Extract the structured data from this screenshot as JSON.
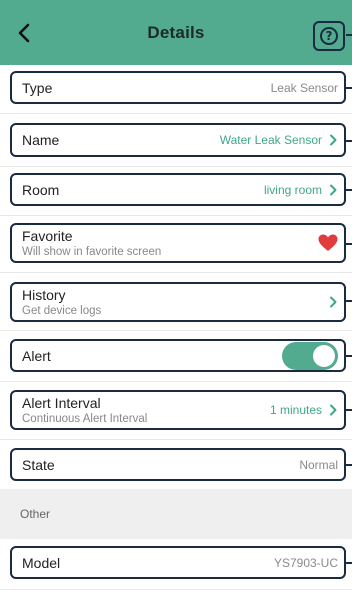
{
  "header": {
    "title": "Details",
    "back_icon": "chevron-left-icon",
    "help_icon": "question-circle-icon",
    "background": "#52aa8f"
  },
  "rows": {
    "type": {
      "label": "Type",
      "value": "Leak Sensor"
    },
    "name": {
      "label": "Name",
      "value": "Water Leak Sensor"
    },
    "room": {
      "label": "Room",
      "value": "living room"
    },
    "favorite": {
      "label": "Favorite",
      "sublabel": "Will show in favorite screen",
      "icon": "heart-icon",
      "color": "#e03c3c"
    },
    "history": {
      "label": "History",
      "sublabel": "Get device logs"
    },
    "alert": {
      "label": "Alert",
      "toggle_on": true
    },
    "alert_interval": {
      "label": "Alert Interval",
      "sublabel": "Continuous Alert Interval",
      "value": "1 minutes"
    },
    "state": {
      "label": "State",
      "value": "Normal"
    }
  },
  "section_other": {
    "label": "Other"
  },
  "model": {
    "label": "Model",
    "value": "YS7903-UC"
  },
  "accent_color": "#3fa789"
}
